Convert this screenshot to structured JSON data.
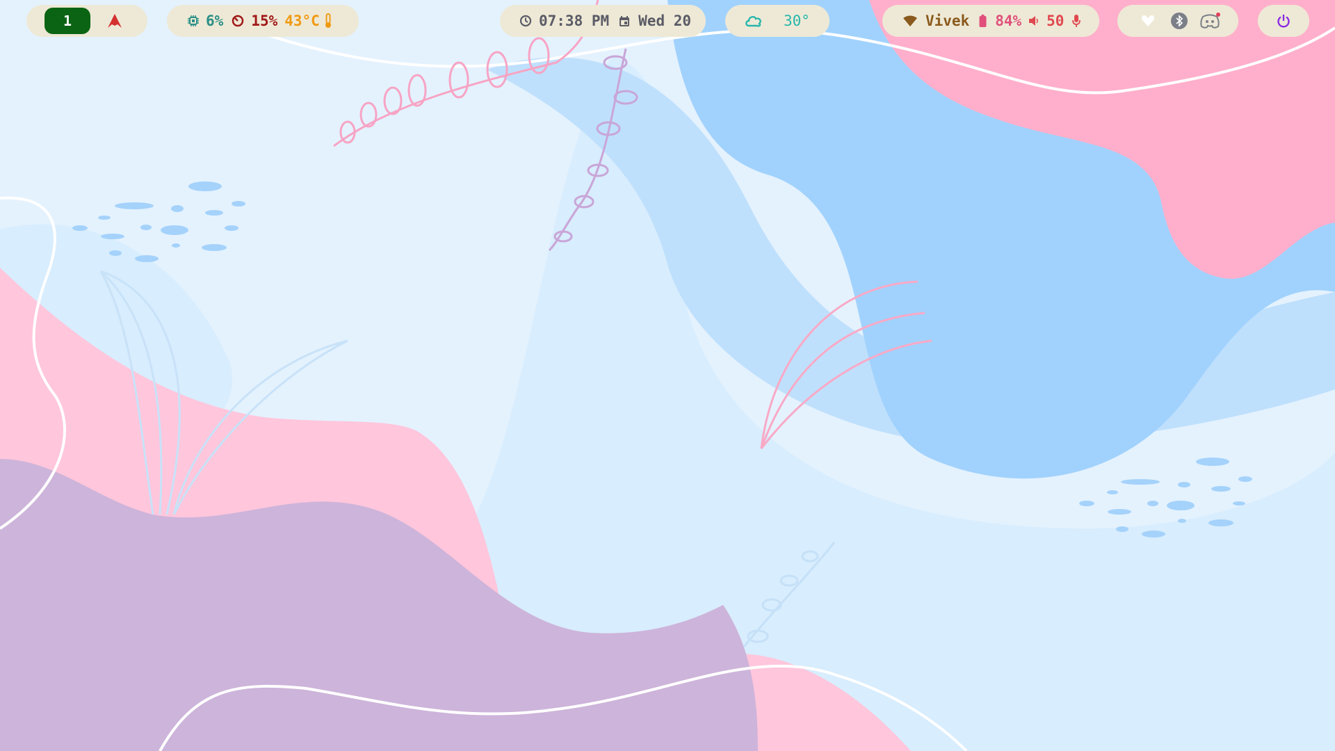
{
  "workspaces": {
    "active_label": "1",
    "active_color": "#0b6413",
    "launcher_icon": "arch-logo-icon",
    "launcher_color": "#d43030"
  },
  "system": {
    "cpu_icon": "cpu-chip-icon",
    "cpu": "6%",
    "cpu_color": "#2a8f86",
    "memory_icon": "gauge-icon",
    "memory": "15%",
    "memory_color": "#a01818",
    "temperature": "43°C",
    "temperature_color": "#f09a14",
    "temperature_icon": "thermometer-icon"
  },
  "clock": {
    "time_icon": "clock-icon",
    "time": "07:38 PM",
    "date_icon": "calendar-icon",
    "date": "Wed 20",
    "text_color": "#5b5b66"
  },
  "weather": {
    "icon": "cloud-icon",
    "temperature": "30°",
    "color": "#27b6ad"
  },
  "status": {
    "wifi_icon": "wifi-icon",
    "wifi_name": "Vivek",
    "wifi_color": "#8a5a1e",
    "battery_icon": "battery-icon",
    "battery": "84%",
    "battery_color": "#e0507a",
    "volume_icon": "speaker-icon",
    "volume": "50",
    "volume_color": "#e04850",
    "mic_icon": "microphone-icon"
  },
  "tray": {
    "items": [
      "heart-icon",
      "bluetooth-icon",
      "discord-icon"
    ]
  },
  "power": {
    "icon": "power-icon",
    "color": "#8a2be2"
  }
}
